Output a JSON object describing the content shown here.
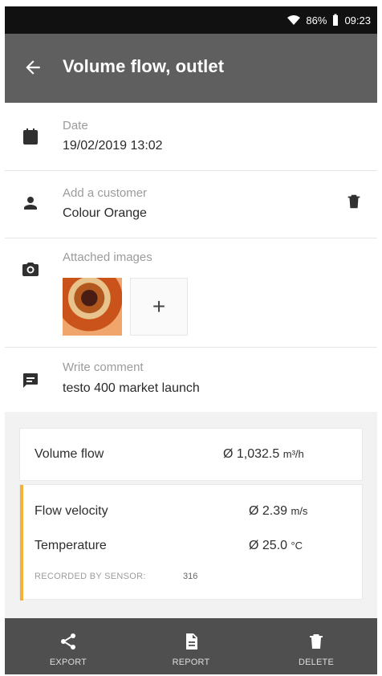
{
  "status": {
    "battery": "86%",
    "time": "09:23"
  },
  "header": {
    "title": "Volume flow, outlet"
  },
  "form": {
    "date": {
      "label": "Date",
      "value": "19/02/2019 13:02"
    },
    "customer": {
      "label": "Add a customer",
      "value": "Colour Orange"
    },
    "images": {
      "label": "Attached images",
      "add": "+"
    },
    "comment": {
      "label": "Write comment",
      "value": "testo 400 market launch"
    }
  },
  "measurements": {
    "volume_flow": {
      "label": "Volume flow",
      "value": "Ø 1,032.5",
      "unit": "m³/h"
    },
    "flow_velocity": {
      "label": "Flow velocity",
      "value": "Ø 2.39",
      "unit": "m/s"
    },
    "temperature": {
      "label": "Temperature",
      "value": "Ø 25.0",
      "unit": "°C"
    },
    "sensor": {
      "label": "RECORDED BY SENSOR:",
      "id": "316"
    }
  },
  "bottom": {
    "export": "EXPORT",
    "report": "REPORT",
    "delete": "DELETE"
  },
  "colors": {
    "header": "#5f5f5f",
    "bottom_bar": "#4f4f4f",
    "accent": "#f3b23a"
  }
}
